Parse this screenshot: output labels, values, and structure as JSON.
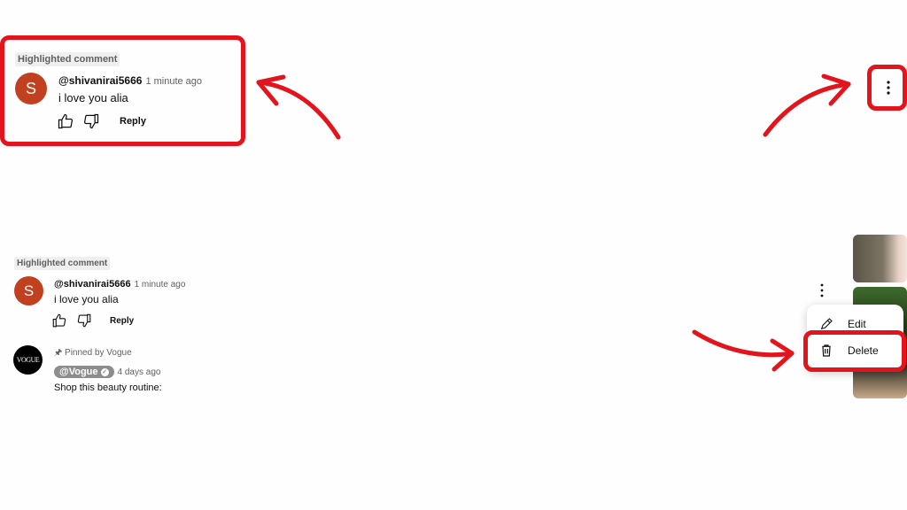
{
  "top_comment": {
    "highlight_label": "Highlighted comment",
    "avatar_letter": "S",
    "author": "@shivanirai5666",
    "time": "1 minute ago",
    "text": "i love you alia",
    "reply_label": "Reply"
  },
  "bottom_comment": {
    "highlight_label": "Highlighted comment",
    "avatar_letter": "S",
    "author": "@shivanirai5666",
    "time": "1 minute ago",
    "text": "i love you alia",
    "reply_label": "Reply"
  },
  "pinned_comment": {
    "pinned_label": "Pinned by Vogue",
    "avatar_text": "VOGUE",
    "author": "@Vogue",
    "time": "4 days ago",
    "text": "Shop this beauty routine:"
  },
  "menu": {
    "items": [
      {
        "label": "Edit",
        "icon": "pencil-icon"
      },
      {
        "label": "Delete",
        "icon": "trash-icon"
      }
    ]
  },
  "colors": {
    "annotation_red": "#e3141c",
    "avatar_bg": "#c1401f"
  }
}
